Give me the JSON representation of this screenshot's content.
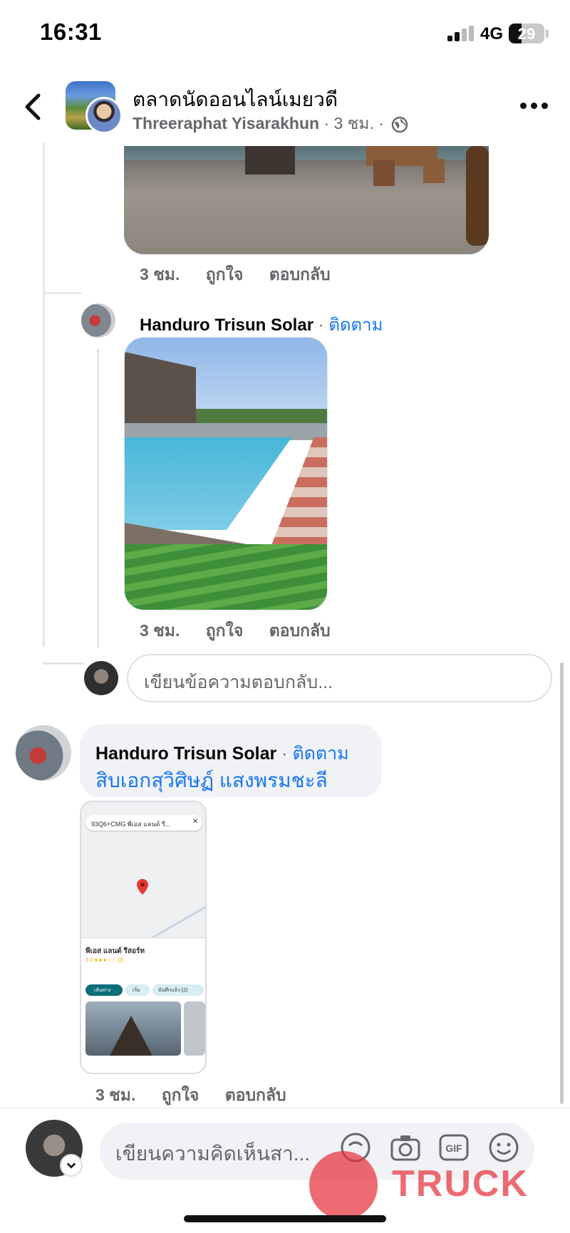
{
  "status_bar": {
    "time": "16:31",
    "network": "4G",
    "battery": "29"
  },
  "header": {
    "group_name": "ตลาดนัดออนไลน์เมยวดี",
    "author": "Threeraphat Yisarakhun",
    "time": "3 ชม.",
    "privacy_icon": "globe-icon"
  },
  "comments": [
    {
      "time": "3 ชม.",
      "like": "ถูกใจ",
      "reply": "ตอบกลับ"
    },
    {
      "name": "Handuro Trisun Solar",
      "follow": "ติดตาม",
      "time": "3 ชม.",
      "like": "ถูกใจ",
      "reply": "ตอบกลับ"
    }
  ],
  "reply_box": {
    "placeholder": "เขียนข้อความตอบกลับ..."
  },
  "main_comment": {
    "name": "Handuro Trisun Solar",
    "follow": "ติดตาม",
    "mention": "สิบเอกสุวิศิษฏ์ แสงพรมชะลี",
    "time": "3 ชม.",
    "like": "ถูกใจ",
    "reply": "ตอบกลับ",
    "map_card": {
      "search": "93Q6+CMG พีเอส แลนด์ รี...",
      "place": "พีเอส แลนด์ รีสอร์ท",
      "rating": "3.0 ★★★☆☆ (3)",
      "chip_directions": "เส้นทาง",
      "chip_start": "เริ่ม",
      "chip_save": "บันทึกแล้ว (2)"
    }
  },
  "dot": "·",
  "composer": {
    "placeholder": "เขียนความคิดเห็นสา...",
    "watermark": "TRUCK"
  }
}
